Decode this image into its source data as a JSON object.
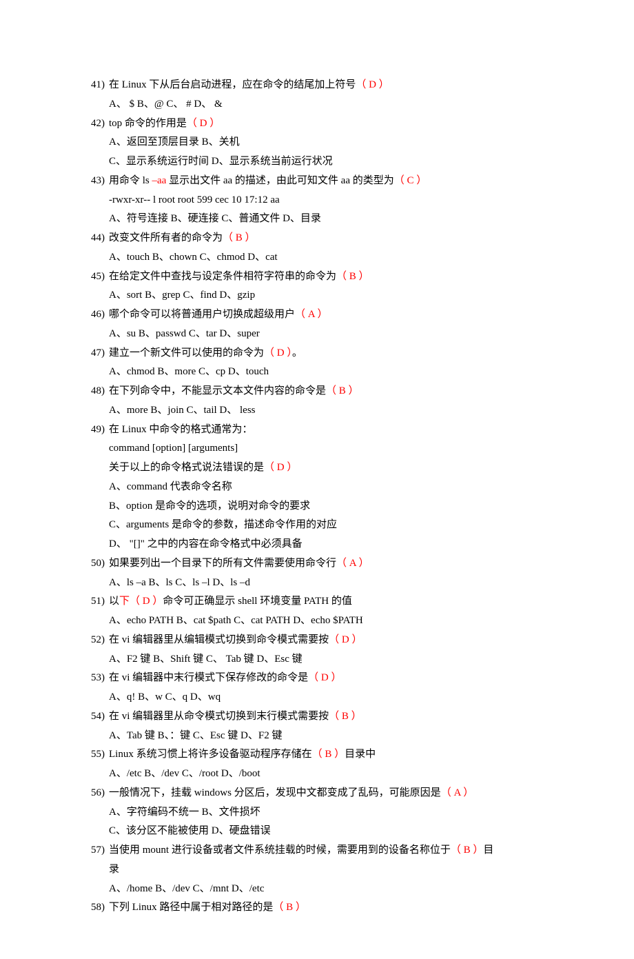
{
  "questions": [
    {
      "num": "41)",
      "stem_pre": "在 Linux 下从后台启动进程，应在命令的结尾加上符号",
      "ans": "（  D  ）",
      "opts": [
        "A、 $   B、@    C、 #   D、 &"
      ]
    },
    {
      "num": "42)",
      "stem_pre": "top 命令的作用是",
      "ans": "（  D  ）",
      "opts": [
        "A、返回至顶层目录        B、关机",
        "C、显示系统运行时间      D、显示系统当前运行状况"
      ]
    },
    {
      "num": "43)",
      "stem_pre": "用命令 ls  ",
      "stem_red_inline": "–aa",
      "stem_post": " 显示出文件 aa 的描述，由此可知文件 aa 的类型为",
      "ans": "（  C  ）",
      "opts": [
        "-rwxr-xr--   l   root   root   599   cec  10  17:12   aa",
        "A、符号连接     B、硬连接       C、普通文件        D、目录"
      ]
    },
    {
      "num": "44)",
      "stem_pre": "改变文件所有者的命令为",
      "ans": "（ B   ）",
      "opts": [
        "A、touch     B、chown        C、chmod       D、cat"
      ]
    },
    {
      "num": "45)",
      "stem_pre": "在给定文件中查找与设定条件相符字符串的命令为",
      "ans": "（  B  ）",
      "opts": [
        "A、sort     B、grep       C、find         D、gzip"
      ]
    },
    {
      "num": "46)",
      "stem_pre": "哪个命令可以将普通用户切换成超级用户",
      "ans": "（  A  ）",
      "opts": [
        "A、su    B、passwd    C、tar      D、super"
      ]
    },
    {
      "num": "47)",
      "stem_pre": "建立一个新文件可以使用的命令为",
      "ans": "（ D   ）",
      "stem_tail": "。",
      "opts": [
        "A、chmod    B、more      C、cp       D、touch"
      ]
    },
    {
      "num": "48)",
      "stem_pre": "在下列命令中，不能显示文本文件内容的命令是",
      "ans": "（  B    ）",
      "opts": [
        "A、more    B、join     C、tail     D、 less"
      ]
    },
    {
      "num": "49)",
      "stem_pre": "在 Linux 中命令的格式通常为：",
      "extra": [
        "command  [option] [arguments]",
        {
          "pre": "关于以上的命令格式说法错误的是",
          "ans": "（ D   ）"
        }
      ],
      "opts": [
        "A、command 代表命令名称",
        "B、option 是命令的选项，说明对命令的要求",
        "C、arguments 是命令的参数，描述命令作用的对应",
        "D、 \"[]\" 之中的内容在命令格式中必须具备"
      ]
    },
    {
      "num": "50)",
      "stem_pre": "如果要列出一个目录下的所有文件需要使用命令行",
      "ans": "（   A   ）",
      "opts": [
        "A、ls  –a    B、ls      C、ls  –l      D、ls  –d"
      ]
    },
    {
      "num": "51)",
      "stem_pre": "以",
      "stem_red_inline": "下（ D   ）",
      "stem_post": "命令可正确显示 shell 环境变量 PATH 的值",
      "opts": [
        "A、echo  PATH   B、cat  $path   C、cat  PATH   D、echo  $PATH"
      ]
    },
    {
      "num": "52)",
      "stem_pre": "在 vi 编辑器里从编辑模式切换到命令模式需要按",
      "ans": "（  D  ）",
      "opts": [
        "A、F2 键 B、Shift 键  C、 Tab 键  D、Esc 键"
      ]
    },
    {
      "num": "53)",
      "stem_pre": "在 vi 编辑器中末行模式下保存修改的命令是",
      "ans": "（ D   ）",
      "opts": [
        "A、q!        B、w        C、q        D、wq"
      ]
    },
    {
      "num": "54)",
      "stem_pre": "在 vi 编辑器里从命令模式切换到末行模式需要按",
      "ans": "（ B   ）",
      "opts": [
        "A、Tab 键   B、：键       C、Esc 键       D、F2 键"
      ]
    },
    {
      "num": "55)",
      "stem_pre": "Linux 系统习惯上将许多设备驱动程序存储在",
      "ans": "（  B     ）",
      "stem_tail": "目录中",
      "opts": [
        "A、/etc         B、/dev     C、/root       D、/boot"
      ]
    },
    {
      "num": "56)",
      "stem_pre": "一般情况下，挂载 windows 分区后，发现中文都变成了乱码，可能原因是",
      "ans": "（   A  ）",
      "opts": [
        "A、字符编码不统一       B、文件损坏",
        "C、该分区不能被使用     D、硬盘错误"
      ]
    },
    {
      "num": "57)",
      "stem_pre": "当使用 mount 进行设备或者文件系统挂载的时候，需要用到的设备名称位于",
      "ans": "（  B   ）",
      "stem_tail": "目",
      "opts_prefix": "录",
      "opts": [
        "A、/home      B、/dev       C、/mnt       D、/etc"
      ]
    },
    {
      "num": "58)",
      "stem_pre": "下列 Linux 路径中属于相对路径的是",
      "ans": "（  B   ）",
      "opts": []
    }
  ]
}
